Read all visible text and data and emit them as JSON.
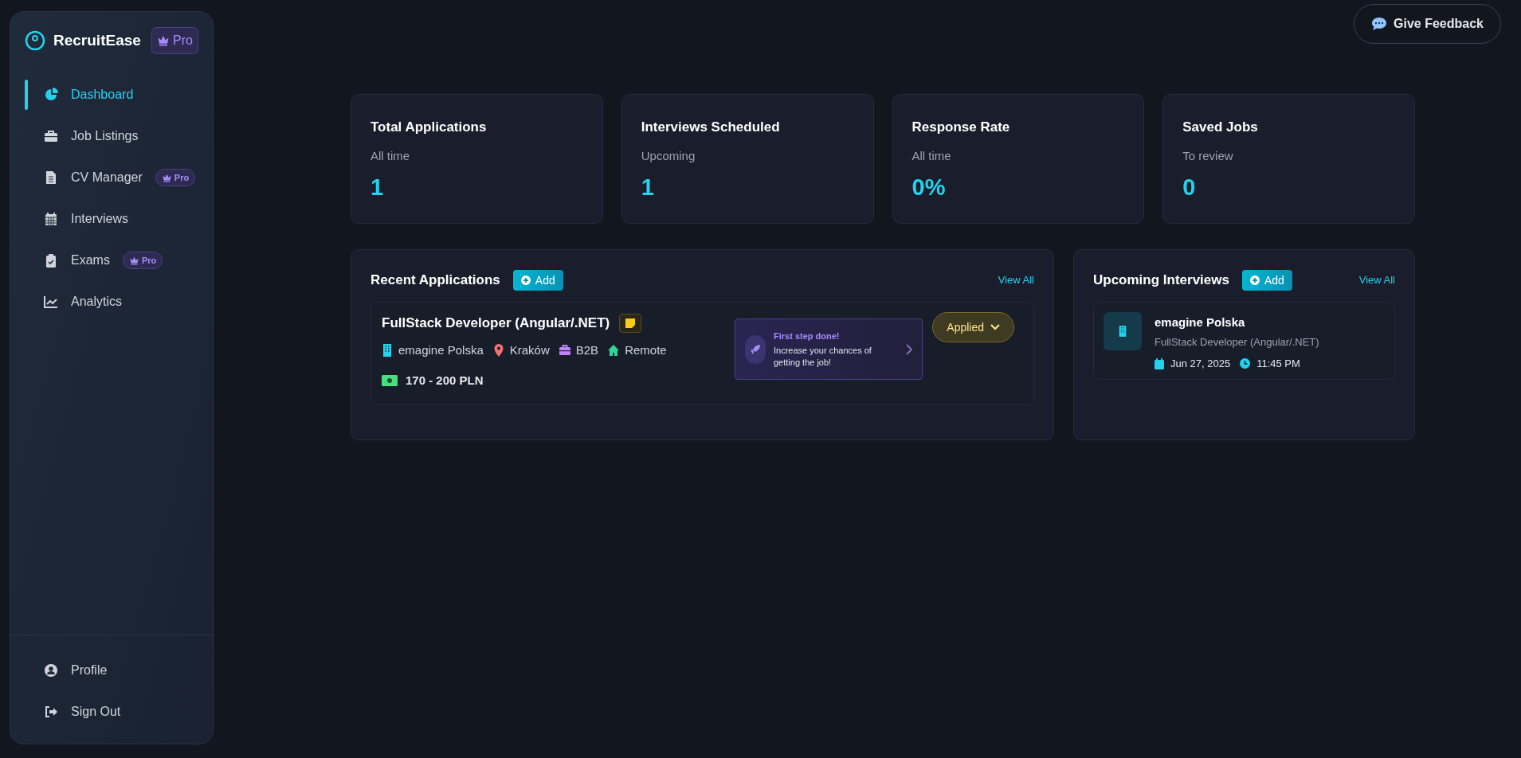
{
  "brand": {
    "name": "RecruitEase",
    "badge": "Pro"
  },
  "nav": [
    {
      "label": "Dashboard",
      "selected": true
    },
    {
      "label": "Job Listings",
      "selected": false
    },
    {
      "label": "CV Manager",
      "selected": false,
      "badge": "Pro"
    },
    {
      "label": "Interviews",
      "selected": false
    },
    {
      "label": "Exams",
      "selected": false,
      "badge": "Pro"
    },
    {
      "label": "Analytics",
      "selected": false
    }
  ],
  "nav_bottom": [
    {
      "label": "Profile"
    },
    {
      "label": "Sign Out"
    }
  ],
  "feedback_button": "Give Feedback",
  "stats": [
    {
      "title": "Total Applications",
      "subtitle": "All time",
      "value": "1"
    },
    {
      "title": "Interviews Scheduled",
      "subtitle": "Upcoming",
      "value": "1"
    },
    {
      "title": "Response Rate",
      "subtitle": "All time",
      "value": "0%"
    },
    {
      "title": "Saved Jobs",
      "subtitle": "To review",
      "value": "0"
    }
  ],
  "recent_applications": {
    "title": "Recent Applications",
    "add": "Add",
    "view_all": "View All",
    "items": [
      {
        "title": "FullStack Developer (Angular/.NET)",
        "tags": [
          {
            "kind": "company",
            "text": "emagine Polska"
          },
          {
            "kind": "location",
            "text": "Kraków"
          },
          {
            "kind": "contract",
            "text": "B2B"
          },
          {
            "kind": "workplace",
            "text": "Remote"
          }
        ],
        "salary": "170 - 200 PLN",
        "tip_title": "First step done!",
        "tip_text": "Increase your chances of getting the job!",
        "status": "Applied"
      }
    ]
  },
  "upcoming_interviews": {
    "title": "Upcoming Interviews",
    "add": "Add",
    "view_all": "View All",
    "items": [
      {
        "company": "emagine Polska",
        "position": "FullStack Developer (Angular/.NET)",
        "date": "Jun 27, 2025",
        "time": "11:45 PM"
      }
    ]
  }
}
